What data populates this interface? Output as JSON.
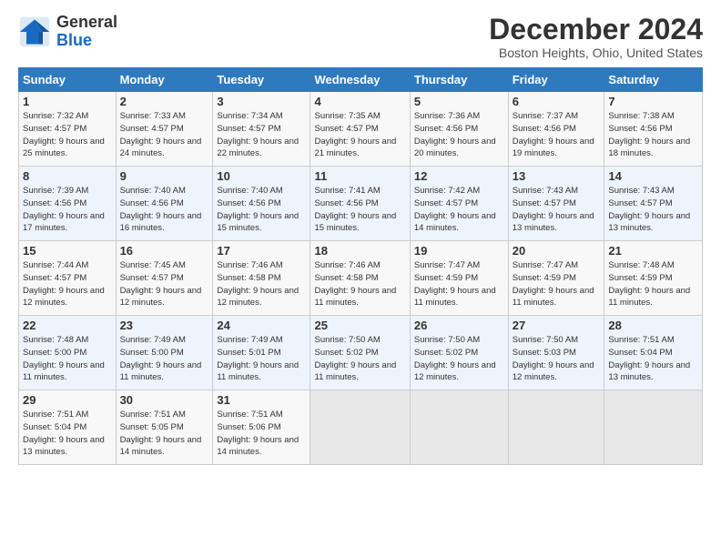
{
  "header": {
    "logo_general": "General",
    "logo_blue": "Blue",
    "month_title": "December 2024",
    "location": "Boston Heights, Ohio, United States"
  },
  "days_of_week": [
    "Sunday",
    "Monday",
    "Tuesday",
    "Wednesday",
    "Thursday",
    "Friday",
    "Saturday"
  ],
  "weeks": [
    [
      {
        "day": "1",
        "sunrise": "Sunrise: 7:32 AM",
        "sunset": "Sunset: 4:57 PM",
        "daylight": "Daylight: 9 hours and 25 minutes."
      },
      {
        "day": "2",
        "sunrise": "Sunrise: 7:33 AM",
        "sunset": "Sunset: 4:57 PM",
        "daylight": "Daylight: 9 hours and 24 minutes."
      },
      {
        "day": "3",
        "sunrise": "Sunrise: 7:34 AM",
        "sunset": "Sunset: 4:57 PM",
        "daylight": "Daylight: 9 hours and 22 minutes."
      },
      {
        "day": "4",
        "sunrise": "Sunrise: 7:35 AM",
        "sunset": "Sunset: 4:57 PM",
        "daylight": "Daylight: 9 hours and 21 minutes."
      },
      {
        "day": "5",
        "sunrise": "Sunrise: 7:36 AM",
        "sunset": "Sunset: 4:56 PM",
        "daylight": "Daylight: 9 hours and 20 minutes."
      },
      {
        "day": "6",
        "sunrise": "Sunrise: 7:37 AM",
        "sunset": "Sunset: 4:56 PM",
        "daylight": "Daylight: 9 hours and 19 minutes."
      },
      {
        "day": "7",
        "sunrise": "Sunrise: 7:38 AM",
        "sunset": "Sunset: 4:56 PM",
        "daylight": "Daylight: 9 hours and 18 minutes."
      }
    ],
    [
      {
        "day": "8",
        "sunrise": "Sunrise: 7:39 AM",
        "sunset": "Sunset: 4:56 PM",
        "daylight": "Daylight: 9 hours and 17 minutes."
      },
      {
        "day": "9",
        "sunrise": "Sunrise: 7:40 AM",
        "sunset": "Sunset: 4:56 PM",
        "daylight": "Daylight: 9 hours and 16 minutes."
      },
      {
        "day": "10",
        "sunrise": "Sunrise: 7:40 AM",
        "sunset": "Sunset: 4:56 PM",
        "daylight": "Daylight: 9 hours and 15 minutes."
      },
      {
        "day": "11",
        "sunrise": "Sunrise: 7:41 AM",
        "sunset": "Sunset: 4:56 PM",
        "daylight": "Daylight: 9 hours and 15 minutes."
      },
      {
        "day": "12",
        "sunrise": "Sunrise: 7:42 AM",
        "sunset": "Sunset: 4:57 PM",
        "daylight": "Daylight: 9 hours and 14 minutes."
      },
      {
        "day": "13",
        "sunrise": "Sunrise: 7:43 AM",
        "sunset": "Sunset: 4:57 PM",
        "daylight": "Daylight: 9 hours and 13 minutes."
      },
      {
        "day": "14",
        "sunrise": "Sunrise: 7:43 AM",
        "sunset": "Sunset: 4:57 PM",
        "daylight": "Daylight: 9 hours and 13 minutes."
      }
    ],
    [
      {
        "day": "15",
        "sunrise": "Sunrise: 7:44 AM",
        "sunset": "Sunset: 4:57 PM",
        "daylight": "Daylight: 9 hours and 12 minutes."
      },
      {
        "day": "16",
        "sunrise": "Sunrise: 7:45 AM",
        "sunset": "Sunset: 4:57 PM",
        "daylight": "Daylight: 9 hours and 12 minutes."
      },
      {
        "day": "17",
        "sunrise": "Sunrise: 7:46 AM",
        "sunset": "Sunset: 4:58 PM",
        "daylight": "Daylight: 9 hours and 12 minutes."
      },
      {
        "day": "18",
        "sunrise": "Sunrise: 7:46 AM",
        "sunset": "Sunset: 4:58 PM",
        "daylight": "Daylight: 9 hours and 11 minutes."
      },
      {
        "day": "19",
        "sunrise": "Sunrise: 7:47 AM",
        "sunset": "Sunset: 4:59 PM",
        "daylight": "Daylight: 9 hours and 11 minutes."
      },
      {
        "day": "20",
        "sunrise": "Sunrise: 7:47 AM",
        "sunset": "Sunset: 4:59 PM",
        "daylight": "Daylight: 9 hours and 11 minutes."
      },
      {
        "day": "21",
        "sunrise": "Sunrise: 7:48 AM",
        "sunset": "Sunset: 4:59 PM",
        "daylight": "Daylight: 9 hours and 11 minutes."
      }
    ],
    [
      {
        "day": "22",
        "sunrise": "Sunrise: 7:48 AM",
        "sunset": "Sunset: 5:00 PM",
        "daylight": "Daylight: 9 hours and 11 minutes."
      },
      {
        "day": "23",
        "sunrise": "Sunrise: 7:49 AM",
        "sunset": "Sunset: 5:00 PM",
        "daylight": "Daylight: 9 hours and 11 minutes."
      },
      {
        "day": "24",
        "sunrise": "Sunrise: 7:49 AM",
        "sunset": "Sunset: 5:01 PM",
        "daylight": "Daylight: 9 hours and 11 minutes."
      },
      {
        "day": "25",
        "sunrise": "Sunrise: 7:50 AM",
        "sunset": "Sunset: 5:02 PM",
        "daylight": "Daylight: 9 hours and 11 minutes."
      },
      {
        "day": "26",
        "sunrise": "Sunrise: 7:50 AM",
        "sunset": "Sunset: 5:02 PM",
        "daylight": "Daylight: 9 hours and 12 minutes."
      },
      {
        "day": "27",
        "sunrise": "Sunrise: 7:50 AM",
        "sunset": "Sunset: 5:03 PM",
        "daylight": "Daylight: 9 hours and 12 minutes."
      },
      {
        "day": "28",
        "sunrise": "Sunrise: 7:51 AM",
        "sunset": "Sunset: 5:04 PM",
        "daylight": "Daylight: 9 hours and 13 minutes."
      }
    ],
    [
      {
        "day": "29",
        "sunrise": "Sunrise: 7:51 AM",
        "sunset": "Sunset: 5:04 PM",
        "daylight": "Daylight: 9 hours and 13 minutes."
      },
      {
        "day": "30",
        "sunrise": "Sunrise: 7:51 AM",
        "sunset": "Sunset: 5:05 PM",
        "daylight": "Daylight: 9 hours and 14 minutes."
      },
      {
        "day": "31",
        "sunrise": "Sunrise: 7:51 AM",
        "sunset": "Sunset: 5:06 PM",
        "daylight": "Daylight: 9 hours and 14 minutes."
      },
      null,
      null,
      null,
      null
    ]
  ]
}
